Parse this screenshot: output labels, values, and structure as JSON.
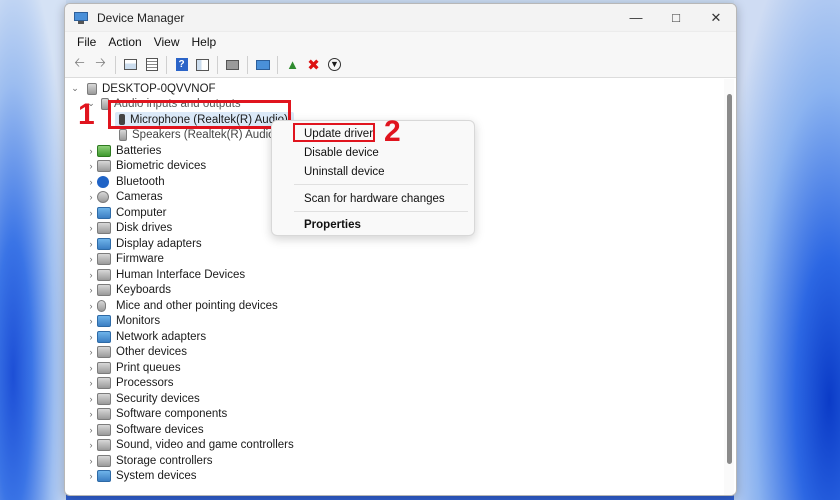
{
  "window": {
    "title": "Device Manager"
  },
  "menu": [
    "File",
    "Action",
    "View",
    "Help"
  ],
  "toolbar_icons": [
    "back-arrow-icon",
    "forward-arrow-icon",
    "properties-grid-icon",
    "list-icon",
    "help-icon",
    "details-icon",
    "print-icon",
    "monitor-icon",
    "update-driver-icon",
    "uninstall-x-icon",
    "download-icon"
  ],
  "tree": {
    "root": "DESKTOP-0QVVNOF",
    "audio": {
      "label": "Audio inputs and outputs",
      "children": [
        "Microphone (Realtek(R) Audio)",
        "Speakers (Realtek(R) Audio)"
      ]
    },
    "categories": [
      "Batteries",
      "Biometric devices",
      "Bluetooth",
      "Cameras",
      "Computer",
      "Disk drives",
      "Display adapters",
      "Firmware",
      "Human Interface Devices",
      "Keyboards",
      "Mice and other pointing devices",
      "Monitors",
      "Network adapters",
      "Other devices",
      "Print queues",
      "Processors",
      "Security devices",
      "Software components",
      "Software devices",
      "Sound, video and game controllers",
      "Storage controllers",
      "System devices"
    ]
  },
  "context_menu": {
    "update": "Update driver",
    "disable": "Disable device",
    "uninstall": "Uninstall device",
    "scan": "Scan for hardware changes",
    "properties": "Properties"
  },
  "annotations": {
    "step1": "1",
    "step2": "2",
    "accent": "#e0141e"
  }
}
